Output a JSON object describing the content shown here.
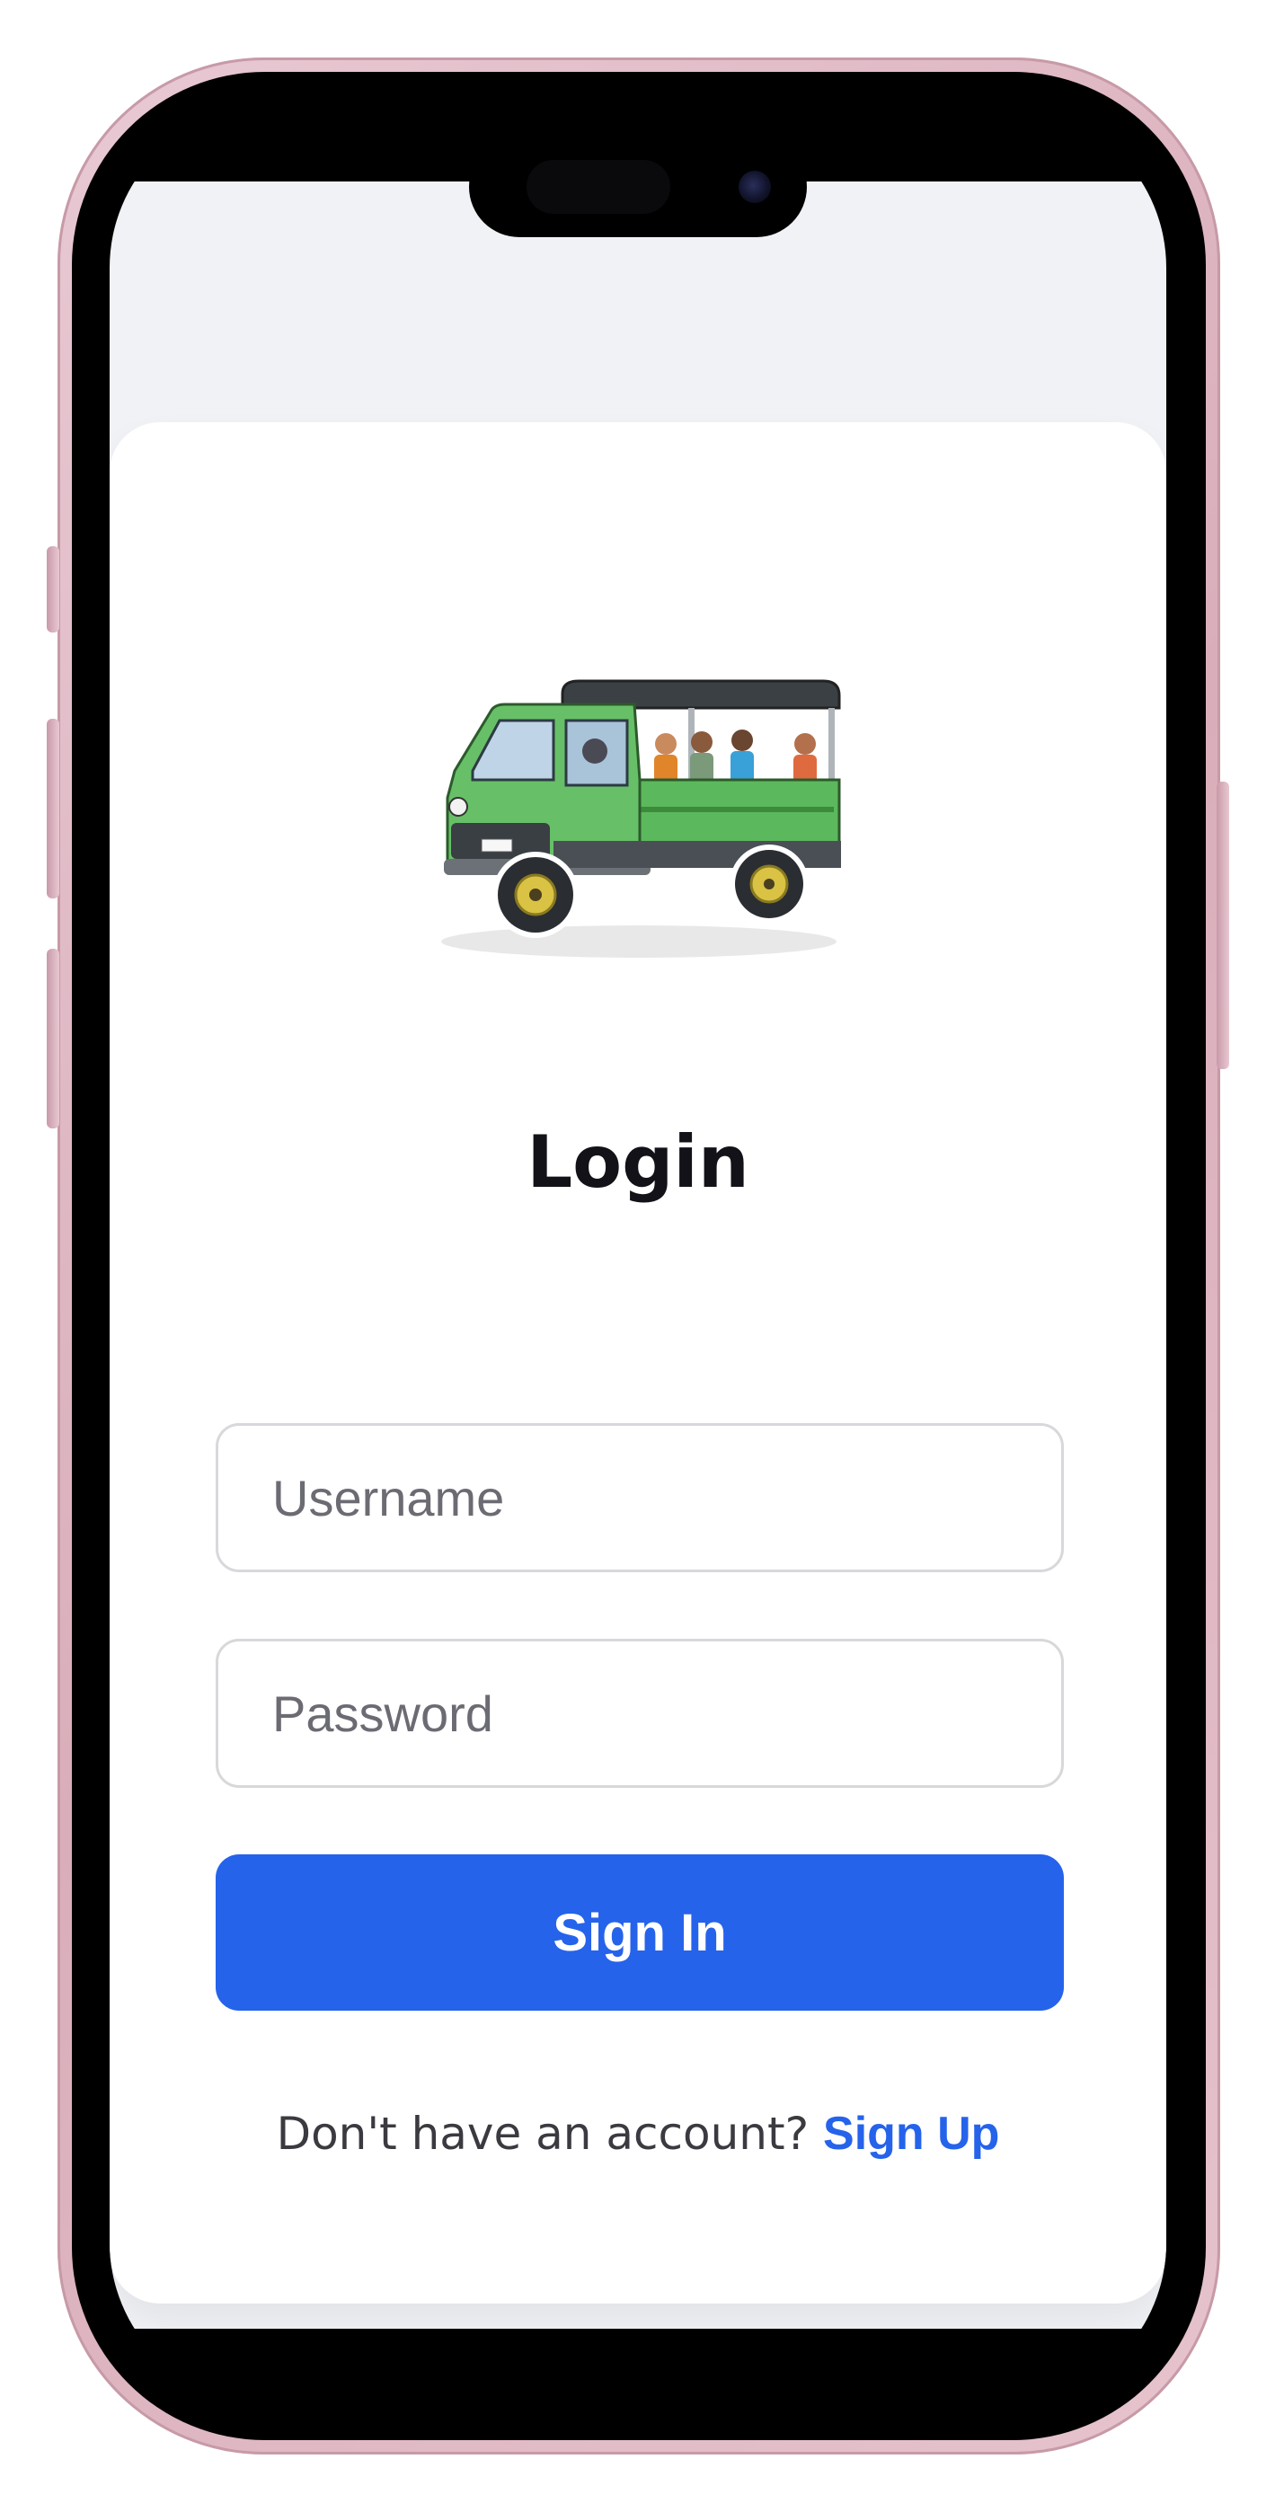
{
  "login": {
    "title": "Login",
    "username_placeholder": "Username",
    "password_placeholder": "Password",
    "submit_label": "Sign In",
    "footer_prompt": "Don't have an account? ",
    "signup_link": "Sign Up"
  },
  "logo": {
    "icon": "songthaew-truck-illustration"
  },
  "colors": {
    "accent": "#2563eb",
    "screen_background": "#f1f2f6",
    "card_background": "#ffffff",
    "title_text": "#121218",
    "truck_green": "#5cb85c"
  }
}
